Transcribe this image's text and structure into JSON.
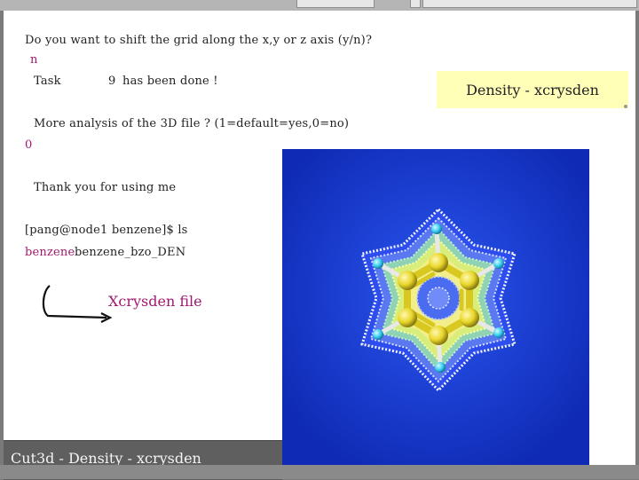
{
  "terminal": {
    "line_shift_prompt": "Do you want to shift the grid along the x,y or z axis (y/n)?",
    "line_answer_n": "n",
    "line_task_label": "Task",
    "line_task_number": "9",
    "line_task_done": "has been done !",
    "line_more_analysis": "More analysis of the 3D file ? (1=default=yes,0=no)",
    "line_answer_0": "0",
    "line_thank_you": "Thank you for using me",
    "line_prompt": "[pang@node1 benzene]$ ls",
    "ls_output": {
      "dir_name": "benzene",
      "file_name": "benzene_bzo_DEN"
    }
  },
  "annotation": {
    "title_box": "Density - xcrysden",
    "xcrysden_label": "Xcrysden file"
  },
  "footer": {
    "slide_label": "Cut3d - Density - xcrysden"
  },
  "colors": {
    "highlight_box": "#ffffb8",
    "magenta_text": "#a0196e",
    "density_background": "#1737d4",
    "carbon_atom": "#e8d62a",
    "hydrogen_atom": "#3ad0f0"
  },
  "image": {
    "subject": "benzene-density-isosurface"
  }
}
